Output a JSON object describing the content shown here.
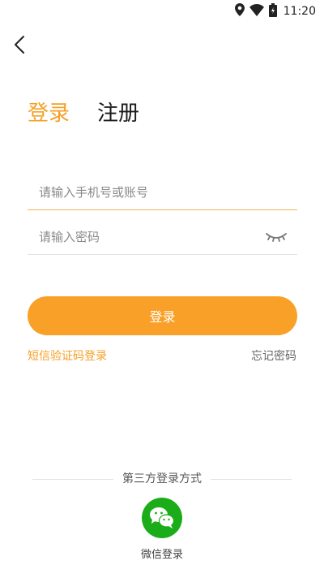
{
  "status_bar": {
    "time": "11:20",
    "icons": [
      "location-icon",
      "wifi-icon",
      "battery-charging-icon"
    ]
  },
  "nav": {
    "back_icon": "chevron-left-icon"
  },
  "tabs": {
    "login": "登录",
    "register": "注册"
  },
  "form": {
    "account_placeholder": "请输入手机号或账号",
    "account_value": "",
    "password_placeholder": "请输入密码",
    "password_value": "",
    "password_toggle_icon": "eye-closed-icon"
  },
  "login_button": "登录",
  "links": {
    "sms_login": "短信验证码登录",
    "forgot_password": "忘记密码"
  },
  "third_party": {
    "title": "第三方登录方式",
    "wechat_label": "微信登录",
    "wechat_icon": "wechat-icon"
  },
  "colors": {
    "accent": "#F8A027",
    "wechat": "#1AAD19",
    "active_underline": "#F5B44A"
  }
}
